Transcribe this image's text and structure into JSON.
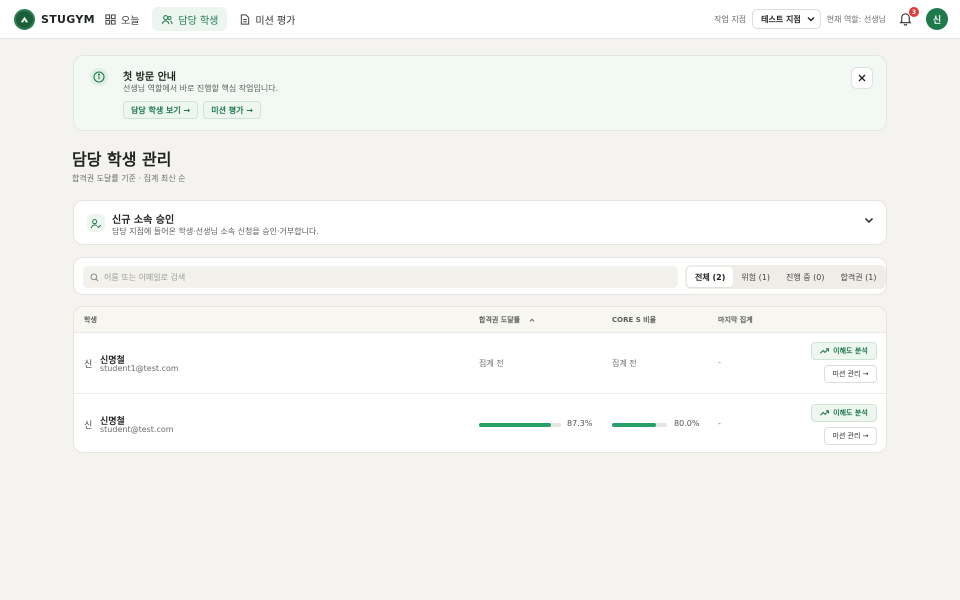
{
  "brand": {
    "name": "STUGYM"
  },
  "nav": {
    "items": [
      {
        "label": "오늘",
        "icon": "grid-icon"
      },
      {
        "label": "담당 학생",
        "icon": "users-icon",
        "active": true
      },
      {
        "label": "미션 평가",
        "icon": "document-icon"
      }
    ]
  },
  "topbar": {
    "branch_label": "작업 지점",
    "branch_value": "테스트 지점",
    "role_label": "현재 역할: 선생님",
    "notification_count": "3",
    "avatar_initial": "신"
  },
  "notice": {
    "title": "첫 방문 안내",
    "description": "선생님 역할에서 바로 진행할 핵심 작업입니다.",
    "actions": [
      "담당 학생 보기 →",
      "미션 평가 →"
    ]
  },
  "page": {
    "title": "담당 학생 관리",
    "subtitle": "합격권 도달률 기준 · 집계 최신 순"
  },
  "approval": {
    "title": "신규 소속 승인",
    "description": "담당 지점에 들어온 학생·선생님 소속 신청을 승인·거부합니다."
  },
  "filter": {
    "search_placeholder": "이름 또는 이메일로 검색",
    "tabs": [
      "전체 (2)",
      "위험 (1)",
      "진행 중 (0)",
      "합격권 (1)"
    ],
    "active_tab": 0
  },
  "table": {
    "columns": [
      "학생",
      "합격권 도달률",
      "CORE S 비율",
      "마지막 집계"
    ],
    "rows": [
      {
        "initial": "신",
        "name": "신명철",
        "email": "student1@test.com",
        "pass_rate_text": "집계 전",
        "core_text": "집계 전",
        "last": "-",
        "analysis_label": "이해도 분석",
        "mission_label": "미션 관리 →"
      },
      {
        "initial": "신",
        "name": "신명철",
        "email": "student@test.com",
        "pass_rate": 87.3,
        "pass_rate_text": "87.3%",
        "core": 80.0,
        "core_text": "80.0%",
        "last": "-",
        "analysis_label": "이해도 분석",
        "mission_label": "미션 관리 →"
      }
    ]
  },
  "colors": {
    "accent": "#1e7a4c",
    "bar": "#27a06a",
    "badge": "#e23b3b"
  }
}
